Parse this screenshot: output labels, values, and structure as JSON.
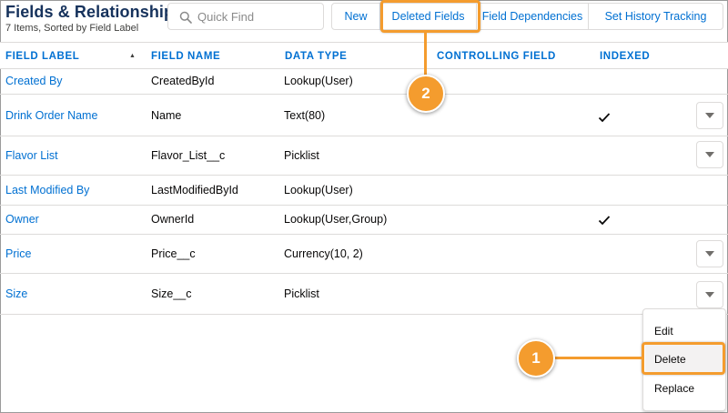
{
  "header": {
    "title": "Fields & Relationships",
    "subtitle": "7 Items, Sorted by Field Label"
  },
  "search": {
    "placeholder": "Quick Find"
  },
  "buttons": {
    "new": "New",
    "deleted_fields": "Deleted Fields",
    "field_dependencies": "Field Dependencies",
    "history_tracking": "Set History Tracking"
  },
  "columns": {
    "field_label": "FIELD LABEL",
    "field_name": "FIELD NAME",
    "data_type": "DATA TYPE",
    "controlling_field": "CONTROLLING FIELD",
    "indexed": "INDEXED"
  },
  "rows": [
    {
      "label": "Created By",
      "name": "CreatedById",
      "type": "Lookup(User)",
      "indexed": false,
      "has_actions": false
    },
    {
      "label": "Drink Order Name",
      "name": "Name",
      "type": "Text(80)",
      "indexed": true,
      "has_actions": true
    },
    {
      "label": "Flavor List",
      "name": "Flavor_List__c",
      "type": "Picklist",
      "indexed": false,
      "has_actions": true
    },
    {
      "label": "Last Modified By",
      "name": "LastModifiedById",
      "type": "Lookup(User)",
      "indexed": false,
      "has_actions": false
    },
    {
      "label": "Owner",
      "name": "OwnerId",
      "type": "Lookup(User,Group)",
      "indexed": true,
      "has_actions": false
    },
    {
      "label": "Price",
      "name": "Price__c",
      "type": "Currency(10, 2)",
      "indexed": false,
      "has_actions": true
    },
    {
      "label": "Size",
      "name": "Size__c",
      "type": "Picklist",
      "indexed": false,
      "has_actions": true
    }
  ],
  "row_menu": {
    "edit": "Edit",
    "delete": "Delete",
    "replace": "Replace"
  },
  "callouts": {
    "one": "1",
    "two": "2"
  },
  "colors": {
    "accent": "#f49c2e",
    "link": "#0070d2",
    "title": "#16325c"
  }
}
